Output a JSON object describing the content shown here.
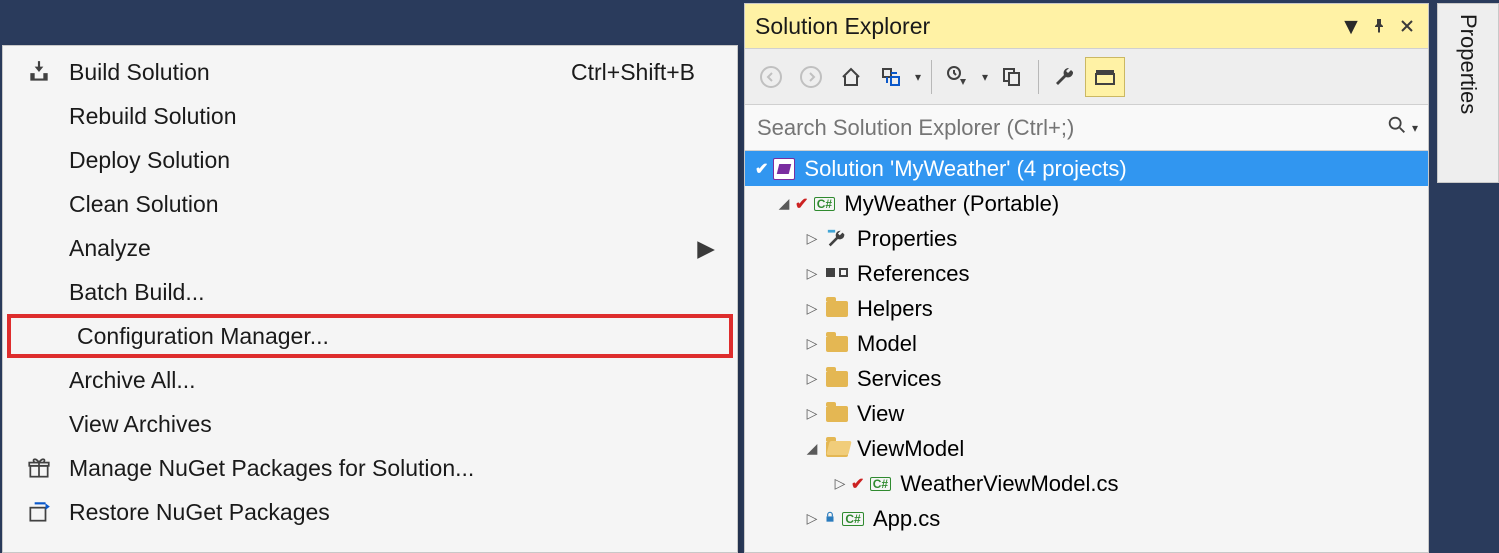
{
  "menu": {
    "items": [
      {
        "label": "Build Solution",
        "shortcut": "Ctrl+Shift+B",
        "icon": "build"
      },
      {
        "label": "Rebuild Solution"
      },
      {
        "label": "Deploy Solution"
      },
      {
        "label": "Clean Solution"
      },
      {
        "label": "Analyze",
        "submenu": true
      },
      {
        "label": "Batch Build..."
      },
      {
        "label": "Configuration Manager...",
        "highlight": true
      },
      {
        "label": "Archive All..."
      },
      {
        "label": "View Archives"
      },
      {
        "label": "Manage NuGet Packages for Solution...",
        "icon": "gift"
      },
      {
        "label": "Restore NuGet Packages",
        "icon": "restore"
      }
    ]
  },
  "solutionExplorer": {
    "title": "Solution Explorer",
    "searchPlaceholder": "Search Solution Explorer (Ctrl+;)",
    "tree": {
      "solution": "Solution 'MyWeather' (4 projects)",
      "project": "MyWeather (Portable)",
      "nodes": [
        {
          "label": "Properties",
          "type": "properties"
        },
        {
          "label": "References",
          "type": "references"
        },
        {
          "label": "Helpers",
          "type": "folder"
        },
        {
          "label": "Model",
          "type": "folder"
        },
        {
          "label": "Services",
          "type": "folder"
        },
        {
          "label": "View",
          "type": "folder"
        },
        {
          "label": "ViewModel",
          "type": "folder-open",
          "expanded": true,
          "children": [
            {
              "label": "WeatherViewModel.cs",
              "type": "csharp",
              "checked": true
            }
          ]
        },
        {
          "label": "App.cs",
          "type": "csharp",
          "locked": true
        }
      ]
    }
  },
  "propertiesTab": "Properties"
}
